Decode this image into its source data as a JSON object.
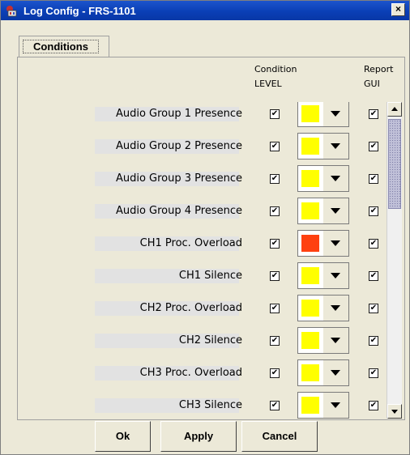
{
  "window": {
    "title": "Log Config - FRS-1101",
    "close_label": "×"
  },
  "tabs": [
    {
      "label": "Conditions"
    }
  ],
  "columns": {
    "condition_line1": "Condition",
    "condition_line2": "LEVEL",
    "report_line1": "Report",
    "report_line2": "GUI"
  },
  "colors": {
    "yellow": "#ffff00",
    "orange": "#ff4010"
  },
  "rows": [
    {
      "label": "Audio Group 1 Presence",
      "level_checked": true,
      "color": "#ffff00",
      "gui_checked": true
    },
    {
      "label": "Audio Group 2 Presence",
      "level_checked": true,
      "color": "#ffff00",
      "gui_checked": true
    },
    {
      "label": "Audio Group 3 Presence",
      "level_checked": true,
      "color": "#ffff00",
      "gui_checked": true
    },
    {
      "label": "Audio Group 4 Presence",
      "level_checked": true,
      "color": "#ffff00",
      "gui_checked": true
    },
    {
      "label": "CH1 Proc. Overload",
      "level_checked": true,
      "color": "#ff4010",
      "gui_checked": true
    },
    {
      "label": "CH1 Silence",
      "level_checked": true,
      "color": "#ffff00",
      "gui_checked": true
    },
    {
      "label": "CH2 Proc. Overload",
      "level_checked": true,
      "color": "#ffff00",
      "gui_checked": true
    },
    {
      "label": "CH2 Silence",
      "level_checked": true,
      "color": "#ffff00",
      "gui_checked": true
    },
    {
      "label": "CH3 Proc. Overload",
      "level_checked": true,
      "color": "#ffff00",
      "gui_checked": true
    },
    {
      "label": "CH3 Silence",
      "level_checked": true,
      "color": "#ffff00",
      "gui_checked": true
    }
  ],
  "buttons": {
    "ok": "Ok",
    "apply": "Apply",
    "cancel": "Cancel"
  },
  "check_glyph": "✔"
}
